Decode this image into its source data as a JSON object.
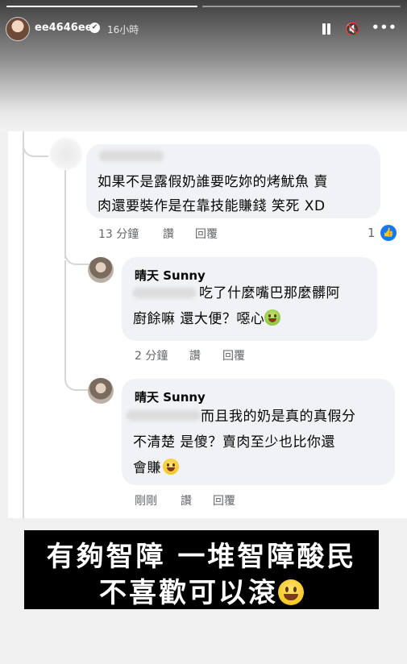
{
  "story": {
    "username": "ee4646ee",
    "time": "16小時",
    "verified_glyph": "✔",
    "mute_glyph": "🔇",
    "more_glyph": "•••"
  },
  "comments": [
    {
      "author": "",
      "lines": [
        "如果不是露假奶誰要吃妳的烤魷魚 賣",
        "肉還要裝作是在靠技能賺錢 笑死 XD"
      ],
      "time": "13 分鐘",
      "like": "讚",
      "reply": "回覆",
      "reactions": "1",
      "reaction_icon": "like-icon"
    },
    {
      "author": "晴天 Sunny",
      "lines": [
        "吃了什麼嘴巴那麼髒阿",
        "廚餘嘛 還大便？噁心"
      ],
      "emoji": "nauseated-face",
      "time": "2 分鐘",
      "like": "讚",
      "reply": "回覆"
    },
    {
      "author": "晴天 Sunny",
      "lines": [
        "而且我的奶是真的真假分",
        "不清楚 是傻？賣肉至少也比你還",
        "會賺"
      ],
      "emoji": "grinning-face",
      "time": "剛剛",
      "like": "讚",
      "reply": "回覆"
    }
  ],
  "caption": {
    "line1": "有夠智障 一堆智障酸民",
    "line2": "不喜歡可以滾",
    "emoji": "grinning-face"
  },
  "colors": {
    "facebook_blue": "#1877f2",
    "bubble_bg": "#f0f2f5",
    "caption_bg": "#000000"
  }
}
